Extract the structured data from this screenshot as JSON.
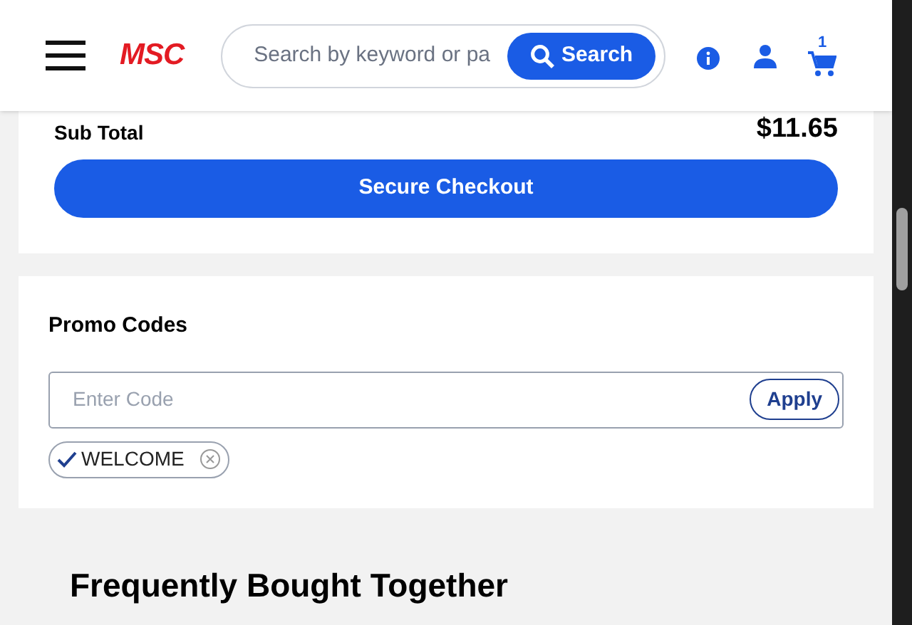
{
  "header": {
    "logo": "MSC",
    "search": {
      "placeholder": "Search by keyword or pa",
      "button": "Search"
    },
    "cart_count": "1"
  },
  "summary": {
    "subtotal_label": "Sub Total",
    "subtotal_value": "$11.65",
    "checkout_button": "Secure Checkout"
  },
  "promo": {
    "title": "Promo Codes",
    "field": {
      "placeholder": "Enter Code"
    },
    "apply_button": "Apply",
    "codes": [
      {
        "code": "WELCOME",
        "applied": true
      }
    ]
  },
  "section_title": "Frequently Bought Together"
}
